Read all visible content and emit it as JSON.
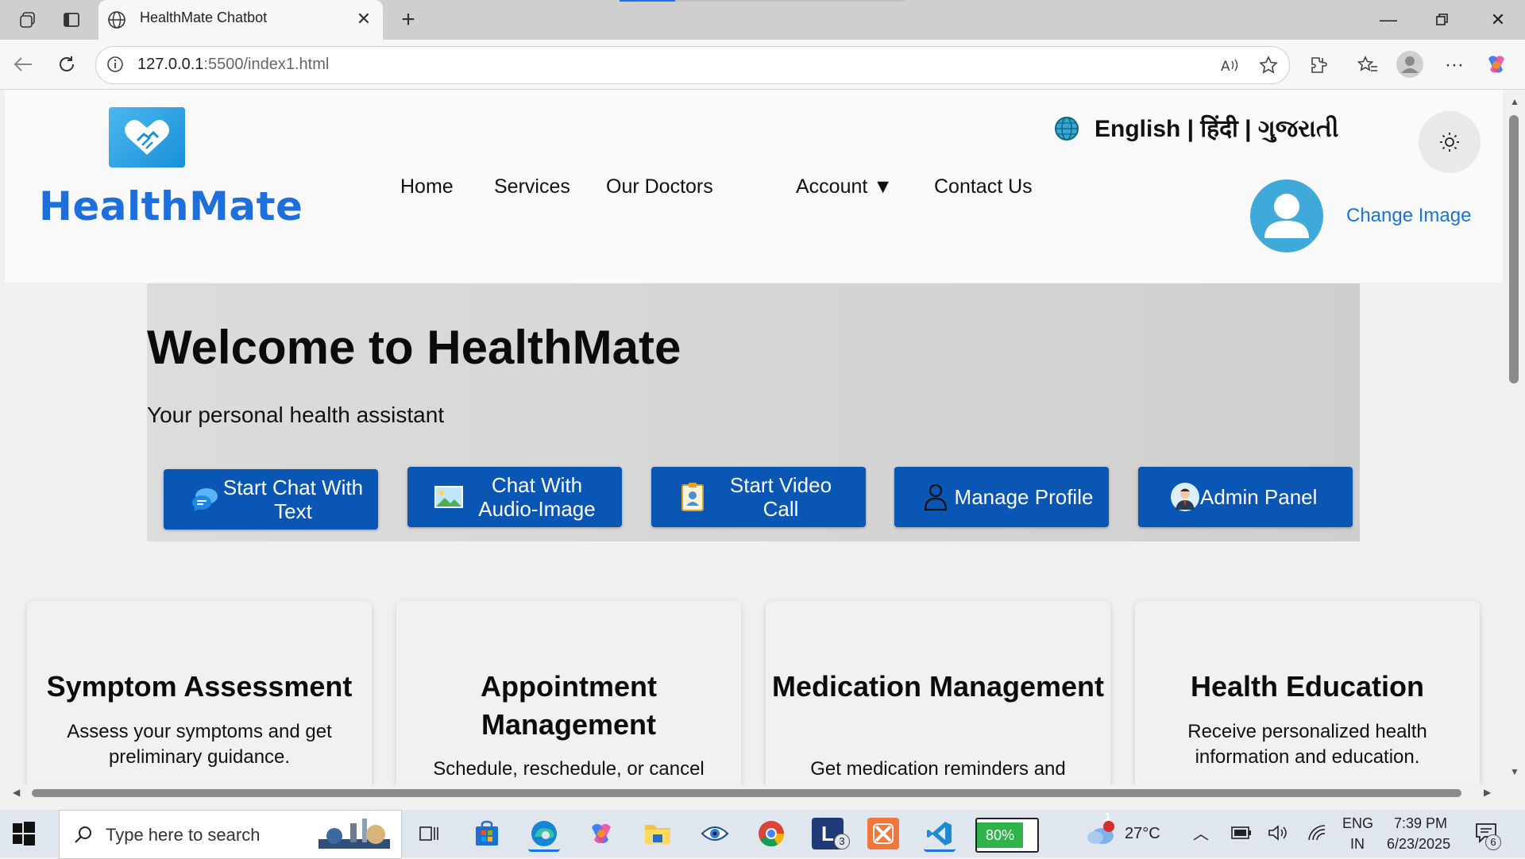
{
  "browser": {
    "tab_title": "HealthMate Chatbot",
    "url_host": "127.0.0.1",
    "url_rest": ":5500/index1.html"
  },
  "header": {
    "brand": "HealthMate",
    "nav": {
      "home": "Home",
      "services": "Services",
      "doctors": "Our Doctors",
      "account": "Account ▼",
      "contact": "Contact Us"
    },
    "languages": "English | हिंदी | ગુજરાતી",
    "change_image": "Change Image"
  },
  "hero": {
    "title": "Welcome to HealthMate",
    "subtitle": "Your personal health assistant",
    "buttons": [
      {
        "label": "Start Chat With Text",
        "icon": "chat-bubbles-icon"
      },
      {
        "label": "Chat With Audio-Image",
        "icon": "image-icon"
      },
      {
        "label": "Start Video Call",
        "icon": "id-badge-icon"
      },
      {
        "label": "Manage Profile",
        "icon": "person-outline-icon"
      },
      {
        "label": "Admin Panel",
        "icon": "admin-avatar-icon"
      }
    ]
  },
  "cards": [
    {
      "title": "Symptom Assessment",
      "text": "Assess your symptoms and get preliminary guidance."
    },
    {
      "title": "Appointment Management",
      "text": "Schedule, reschedule, or cancel"
    },
    {
      "title": "Medication Management",
      "text": "Get medication reminders and"
    },
    {
      "title": "Health Education",
      "text": "Receive personalized health information and education."
    }
  ],
  "taskbar": {
    "search_placeholder": "Type here to search",
    "battery": "80%",
    "weather": "27°C",
    "weather_badge": "1",
    "lang_top": "ENG",
    "lang_bottom": "IN",
    "time": "7:39 PM",
    "date": "6/23/2025",
    "notif_count": "6",
    "launcher_badge": "3"
  },
  "colors": {
    "brand_blue": "#1c6fdc",
    "button_blue": "#0a56b5",
    "link_blue": "#1a73d9",
    "avatar_bg": "#3fa9d9"
  }
}
